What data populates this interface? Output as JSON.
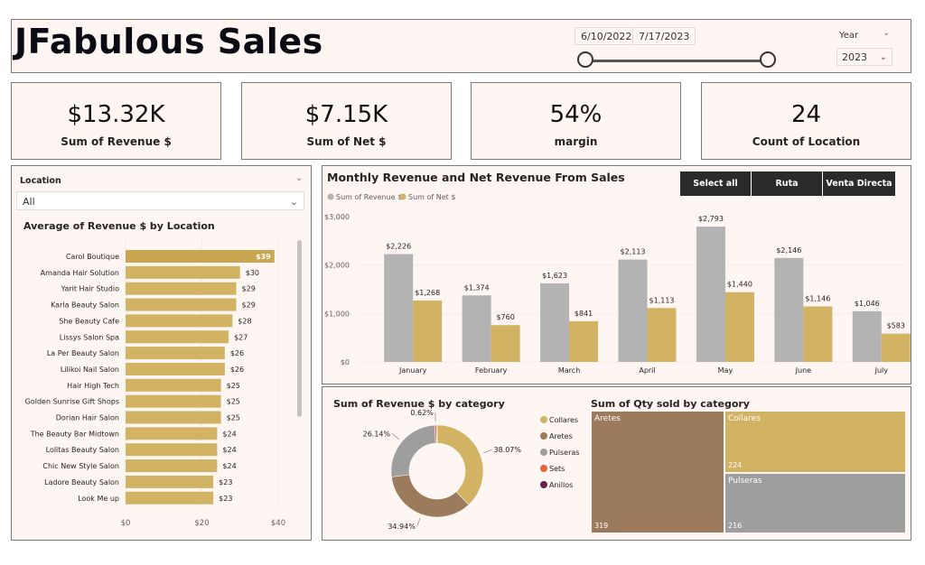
{
  "header": {
    "title": "JFabulous Sales",
    "date_start": "6/10/2022",
    "date_end": "7/17/2023",
    "year_label": "Year",
    "year_value": "2023"
  },
  "kpis": [
    {
      "value": "$13.32K",
      "label": "Sum of Revenue $"
    },
    {
      "value": "$7.15K",
      "label": "Sum of Net $"
    },
    {
      "value": "54%",
      "label": "margin"
    },
    {
      "value": "24",
      "label": "Count of Location"
    }
  ],
  "location_filter": {
    "label": "Location",
    "value": "All"
  },
  "buttons": {
    "select_all": "Select all",
    "ruta": "Ruta",
    "venta_directa": "Venta Directa"
  },
  "colors": {
    "revenue": "#b3b3b3",
    "net": "#d2b263",
    "bar": "#d2b263",
    "highlight_bar": "#c9a54f"
  },
  "chart_data": [
    {
      "type": "bar",
      "orientation": "horizontal",
      "title": "Average of Revenue $ by Location",
      "categories": [
        "Carol Boutique",
        "Amanda Hair Solution",
        "Yarit Hair Studio",
        "Karla Beauty Salon",
        "She Beauty Cafe",
        "Lissys Salon Spa",
        "La Per Beauty Salon",
        "Lilikoi Nail Salon",
        "Hair High Tech",
        "Golden Sunrise Gift Shops",
        "Dorian Hair Salon",
        "The Beauty Bar Midtown",
        "Lolitas Beauty Salon",
        "Chic New Style Salon",
        "Ladore Beauty Salon",
        "Look Me up"
      ],
      "values": [
        39,
        30,
        29,
        29,
        28,
        27,
        26,
        26,
        25,
        25,
        25,
        24,
        24,
        24,
        23,
        23
      ],
      "value_labels": [
        "$39",
        "$30",
        "$29",
        "$29",
        "$28",
        "$27",
        "$26",
        "$26",
        "$25",
        "$25",
        "$25",
        "$24",
        "$24",
        "$24",
        "$23",
        "$23"
      ],
      "xlim": [
        0,
        40
      ],
      "xticks": [
        "$0",
        "$20",
        "$40"
      ]
    },
    {
      "type": "bar",
      "title": "Monthly Revenue and Net Revenue From Sales",
      "categories": [
        "January",
        "February",
        "March",
        "April",
        "May",
        "June",
        "July"
      ],
      "series": [
        {
          "name": "Sum of Revenue $",
          "values": [
            2226,
            1374,
            1623,
            2113,
            2793,
            2146,
            1046
          ],
          "labels": [
            "$2,226",
            "$1,374",
            "$1,623",
            "$2,113",
            "$2,793",
            "$2,146",
            "$1,046"
          ]
        },
        {
          "name": "Sum of Net $",
          "values": [
            1268,
            760,
            841,
            1113,
            1440,
            1146,
            583
          ],
          "labels": [
            "$1,268",
            "$760",
            "$841",
            "$1,113",
            "$1,440",
            "$1,146",
            "$583"
          ]
        }
      ],
      "ylim": [
        0,
        3000
      ],
      "yticks": [
        "$0",
        "$1,000",
        "$2,000",
        "$3,000"
      ],
      "legend": "top-left"
    },
    {
      "type": "pie",
      "variant": "donut",
      "title": "Sum of Revenue $ by category",
      "categories": [
        "Collares",
        "Aretes",
        "Pulseras",
        "Sets",
        "Anillos"
      ],
      "values": [
        38.07,
        34.94,
        26.14,
        0.62,
        0.23
      ],
      "labels": [
        "38.07%",
        "34.94%",
        "26.14%",
        "0.62%",
        ""
      ],
      "colors": [
        "#d2b263",
        "#9b7b5b",
        "#9e9e9e",
        "#e0673a",
        "#6b1f4a"
      ],
      "legend": "right"
    },
    {
      "type": "treemap",
      "title": "Sum of Qty sold by category",
      "categories": [
        "Aretes",
        "Collares",
        "Pulseras"
      ],
      "values": [
        319,
        224,
        216
      ],
      "colors": [
        "#9b7b5b",
        "#d2b263",
        "#9e9e9e"
      ]
    }
  ]
}
